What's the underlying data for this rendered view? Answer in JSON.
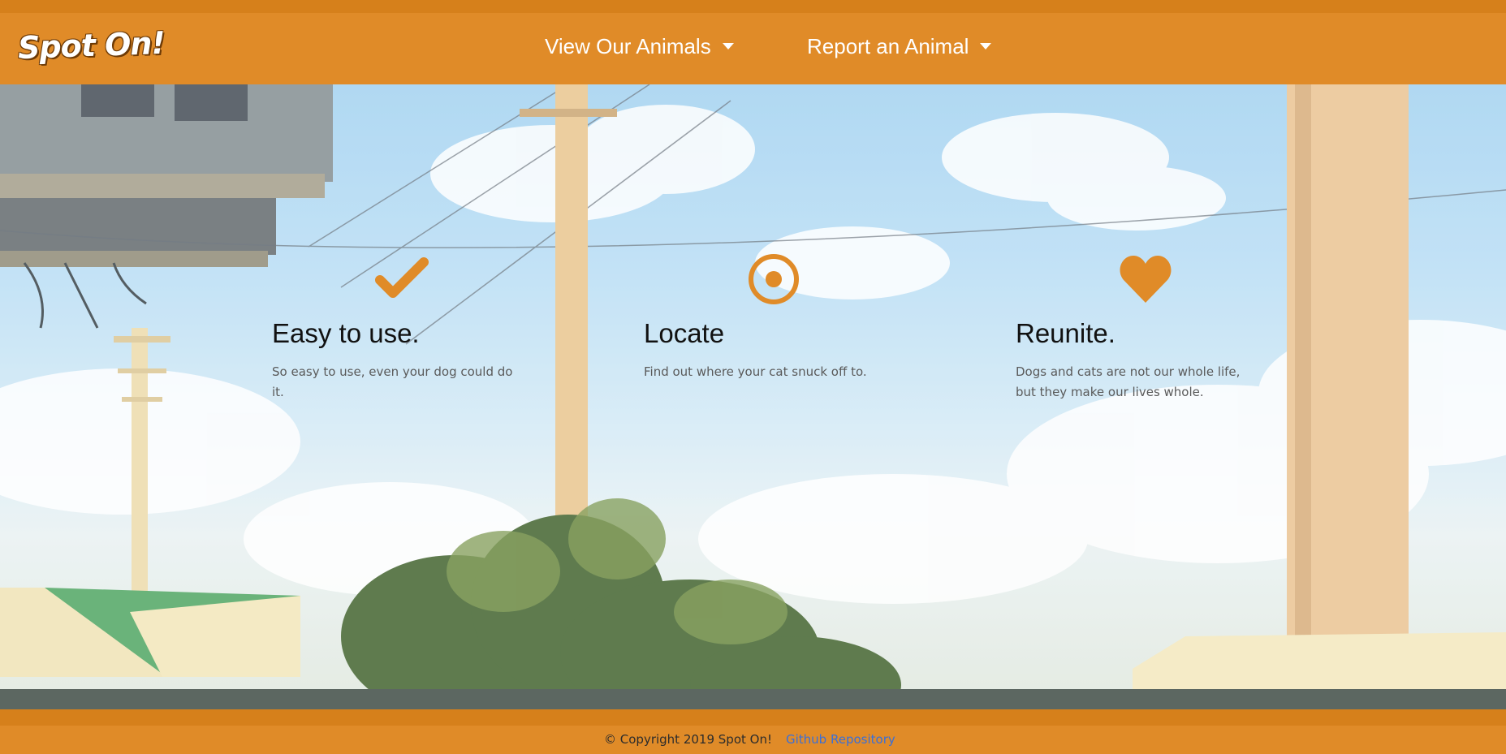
{
  "brand": {
    "name": "Spot On!"
  },
  "nav": {
    "items": [
      {
        "label": "View Our Animals",
        "icon": "caret-down-icon"
      },
      {
        "label": "Report an Animal",
        "icon": "caret-down-icon"
      }
    ]
  },
  "features": [
    {
      "icon": "checkmark-icon",
      "title": "Easy to use.",
      "text": "So easy to use, even your dog could do it."
    },
    {
      "icon": "target-icon",
      "title": "Locate",
      "text": "Find out where your cat snuck off to."
    },
    {
      "icon": "heart-icon",
      "title": "Reunite.",
      "text": "Dogs and cats are not our whole life, but they make our lives whole."
    }
  ],
  "footer": {
    "copyright": "© Copyright 2019 Spot On!",
    "github_label": "Github Repository"
  },
  "colors": {
    "accent": "#e08b28",
    "accent_dark": "#d6801b",
    "link": "#3a6fd8"
  }
}
